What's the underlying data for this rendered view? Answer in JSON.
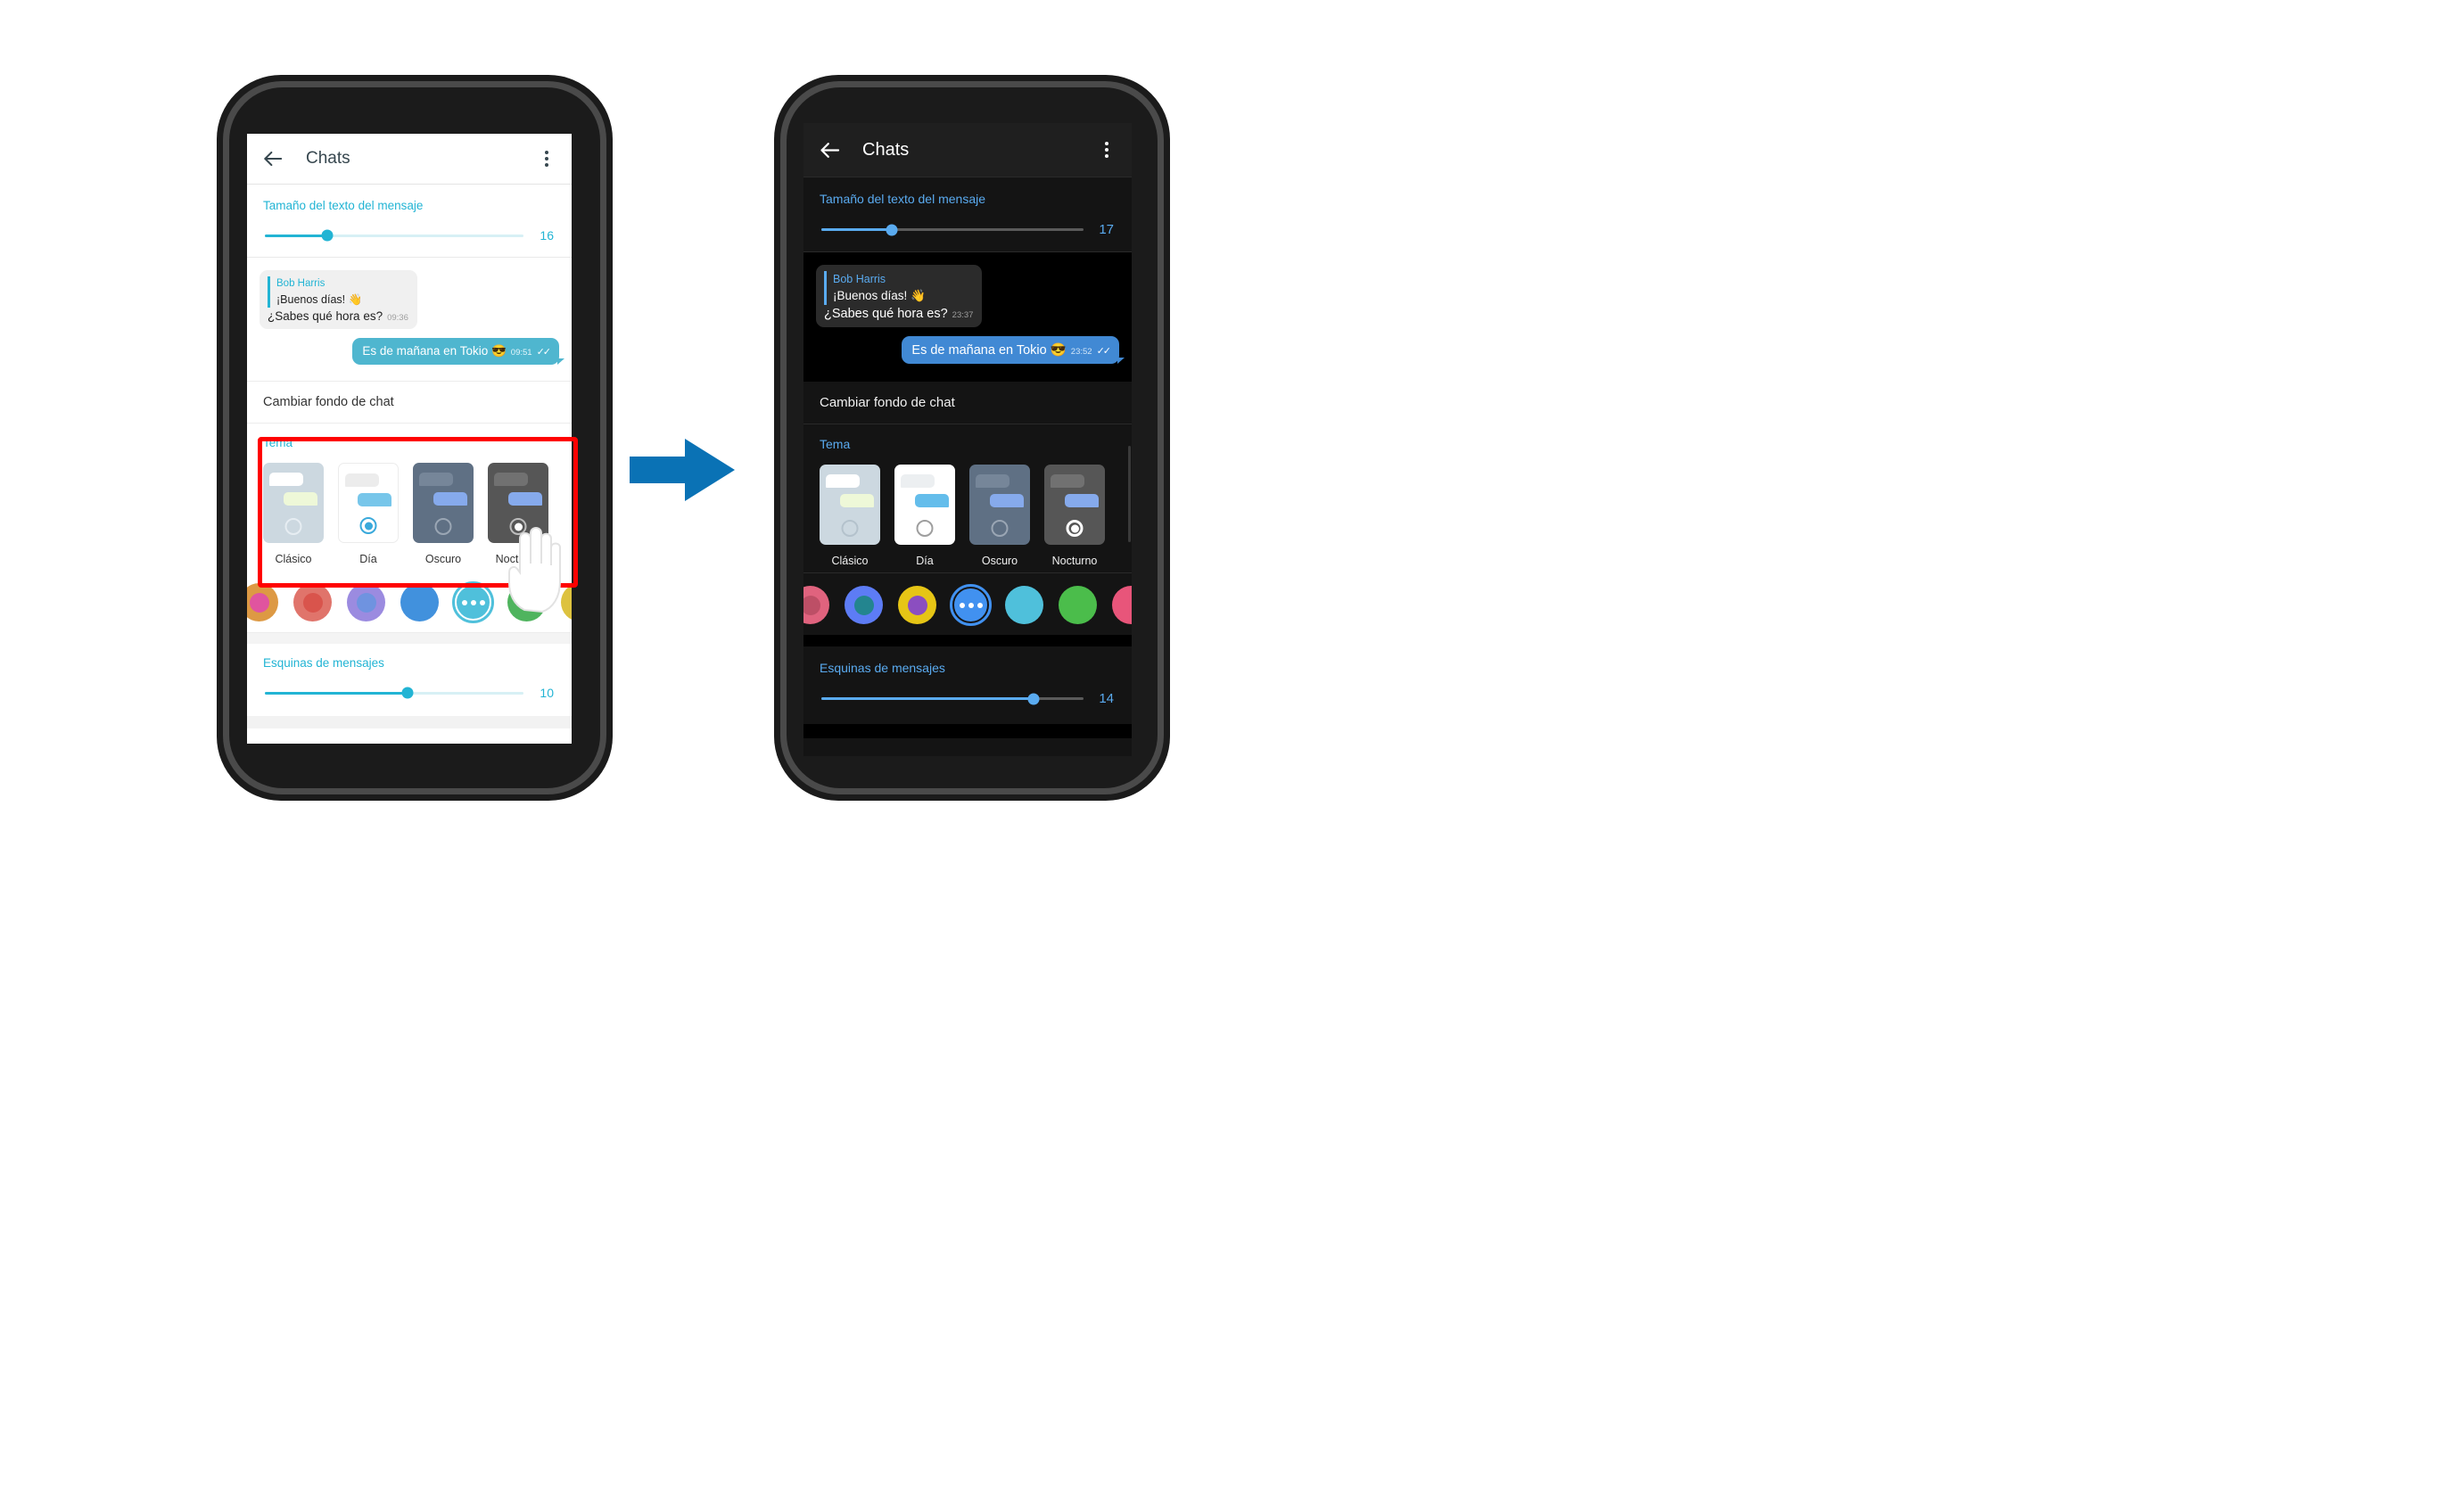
{
  "app": {
    "title": "Chats",
    "back_icon": "back-arrow-icon",
    "menu_icon": "kebab-menu-icon"
  },
  "colors": {
    "accent_light": "#22b4d4",
    "accent_dark": "#5aabf0",
    "highlight_box": "#ff0000",
    "arrow": "#0a72b5",
    "phone_body": "#1b1b1b",
    "phone_rim": "#4a4a4a",
    "screen_light_bg": "#ffffff",
    "screen_dark_bg": "#141414"
  },
  "left_phone": {
    "theme_mode": "light",
    "text_size": {
      "label": "Tamaño del texto del mensaje",
      "value": "16",
      "fill_percent": 24
    },
    "chat": {
      "quote_name": "Bob Harris",
      "quote_text": "¡Buenos días! 👋",
      "incoming_text": "¿Sabes qué hora es?",
      "incoming_time": "09:36",
      "outgoing_text": "Es de mañana en Tokio 😎",
      "outgoing_time": "09:51",
      "ticks": "✓✓"
    },
    "wallpaper_row": "Cambiar fondo de chat",
    "theme": {
      "label": "Tema",
      "options": [
        {
          "name": "Clásico",
          "selected": false
        },
        {
          "name": "Día",
          "selected": true
        },
        {
          "name": "Oscuro",
          "selected": false
        },
        {
          "name": "Nocturno",
          "selected": false
        }
      ]
    },
    "swatches": [
      {
        "name": "orange-pink",
        "outer": "#dd9944",
        "inner": "#e0549f",
        "selected": false
      },
      {
        "name": "red",
        "outer": "#e0746b",
        "inner": "#d9544c",
        "selected": false
      },
      {
        "name": "purple-blue",
        "outer": "#9b8be0",
        "inner": "#6f93e0",
        "selected": false
      },
      {
        "name": "blue",
        "outer": "#4191dd",
        "inner": "#4191dd",
        "selected": false
      },
      {
        "name": "more-options",
        "outer": "#4fc0db",
        "inner": "#4fc0db",
        "selected": true
      },
      {
        "name": "green",
        "outer": "#4fb45e",
        "inner": "#4fb45e",
        "selected": false
      },
      {
        "name": "yellow",
        "outer": "#ddc23f",
        "inner": "#ddc23f",
        "selected": false
      }
    ],
    "corners": {
      "label": "Esquinas de mensajes",
      "value": "10",
      "fill_percent": 55
    }
  },
  "right_phone": {
    "theme_mode": "dark",
    "text_size": {
      "label": "Tamaño del texto del mensaje",
      "value": "17",
      "fill_percent": 27
    },
    "chat": {
      "quote_name": "Bob Harris",
      "quote_text": "¡Buenos días! 👋",
      "incoming_text": "¿Sabes qué hora es?",
      "incoming_time": "23:37",
      "outgoing_text": "Es de mañana en Tokio 😎",
      "outgoing_time": "23:52",
      "ticks": "✓✓"
    },
    "wallpaper_row": "Cambiar fondo de chat",
    "theme": {
      "label": "Tema",
      "options": [
        {
          "name": "Clásico",
          "selected": false
        },
        {
          "name": "Día",
          "selected": false
        },
        {
          "name": "Oscuro",
          "selected": false
        },
        {
          "name": "Nocturno",
          "selected": true
        }
      ]
    },
    "swatches": [
      {
        "name": "pink",
        "outer": "#e0637e",
        "inner": "#bd4f66",
        "selected": false
      },
      {
        "name": "blue-teal",
        "outer": "#5d7cf5",
        "inner": "#23858f",
        "selected": false
      },
      {
        "name": "yellow-purple",
        "outer": "#e6c515",
        "inner": "#8b4ec0",
        "selected": false
      },
      {
        "name": "more-options",
        "outer": "#4191f0",
        "inner": "#4191f0",
        "selected": true
      },
      {
        "name": "cyan",
        "outer": "#4fc0db",
        "inner": "#4fc0db",
        "selected": false
      },
      {
        "name": "green",
        "outer": "#4bbd4b",
        "inner": "#4bbd4b",
        "selected": false
      },
      {
        "name": "pink2",
        "outer": "#e8557a",
        "inner": "#e8557a",
        "selected": false
      }
    ],
    "corners": {
      "label": "Esquinas de mensajes",
      "value": "14",
      "fill_percent": 81
    }
  },
  "annotation": {
    "highlight_target": "Tema",
    "arrow_direction": "right",
    "cursor": "tap-hand-cursor"
  }
}
